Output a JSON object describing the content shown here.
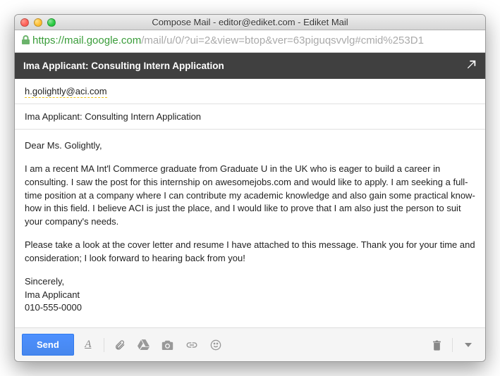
{
  "window": {
    "title": "Compose Mail - editor@ediket.com - Ediket Mail"
  },
  "url": {
    "scheme": "https://",
    "host": "mail.google.com",
    "path": "/mail/u/0/?ui=2&view=btop&ver=63piguqsvvlg#cmid%253D1"
  },
  "compose": {
    "header": "Ima Applicant: Consulting Intern Application",
    "to": "h.golightly@aci.com",
    "subject": "Ima Applicant: Consulting Intern Application",
    "body": {
      "greeting": "Dear Ms. Golightly,",
      "p1": "I am a recent MA Int'l Commerce graduate from Graduate U in the UK who is eager to build a career in consulting. I saw the post for this internship on awesomejobs.com and would like to apply. I am seeking a full-time position at a company where I can contribute my academic knowledge and also gain some practical know-how in this field. I believe ACI is just the place, and I would like to prove that I am also just the person to suit your company's needs.",
      "p2": "Please take a look at the cover letter and resume I have attached to this message. Thank you for your time and consideration; I look forward to hearing back from you!",
      "closing": "Sincerely,",
      "name": "Ima Applicant",
      "phone": "010-555-0000"
    }
  },
  "toolbar": {
    "send": "Send"
  }
}
